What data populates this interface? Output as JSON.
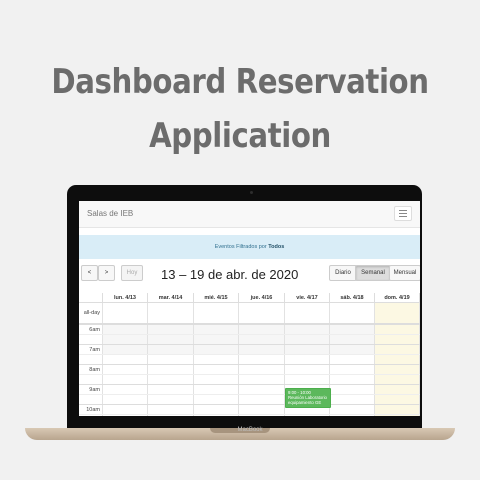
{
  "banner": {
    "line1": "Dashboard Reservation",
    "line2": "Application"
  },
  "device": {
    "label": "MacBook"
  },
  "app": {
    "brand": "Salas de IEB",
    "menu_icon": "hamburger-icon",
    "filter": {
      "prefix": "Eventos Filtrados por",
      "value": "Todos"
    },
    "toolbar": {
      "prev": "<",
      "next": ">",
      "today": "Hoy",
      "title": "13 – 19 de abr. de 2020",
      "views": [
        "Diario",
        "Semanal",
        "Mensual"
      ],
      "active_view": "Semanal"
    },
    "calendar": {
      "columns": [
        "lun. 4/13",
        "mar. 4/14",
        "mié. 4/15",
        "jue. 4/16",
        "vie. 4/17",
        "sáb. 4/18",
        "dom. 4/19"
      ],
      "allday_label": "all-day",
      "times": [
        "6am",
        "7am",
        "8am",
        "9am",
        "10am"
      ],
      "today_color": "#fcf8e3",
      "event": {
        "time": "9:00 - 10:00",
        "title": "Reunión Laboratorio equipamiento GE",
        "color": "#5cb85c"
      }
    }
  }
}
